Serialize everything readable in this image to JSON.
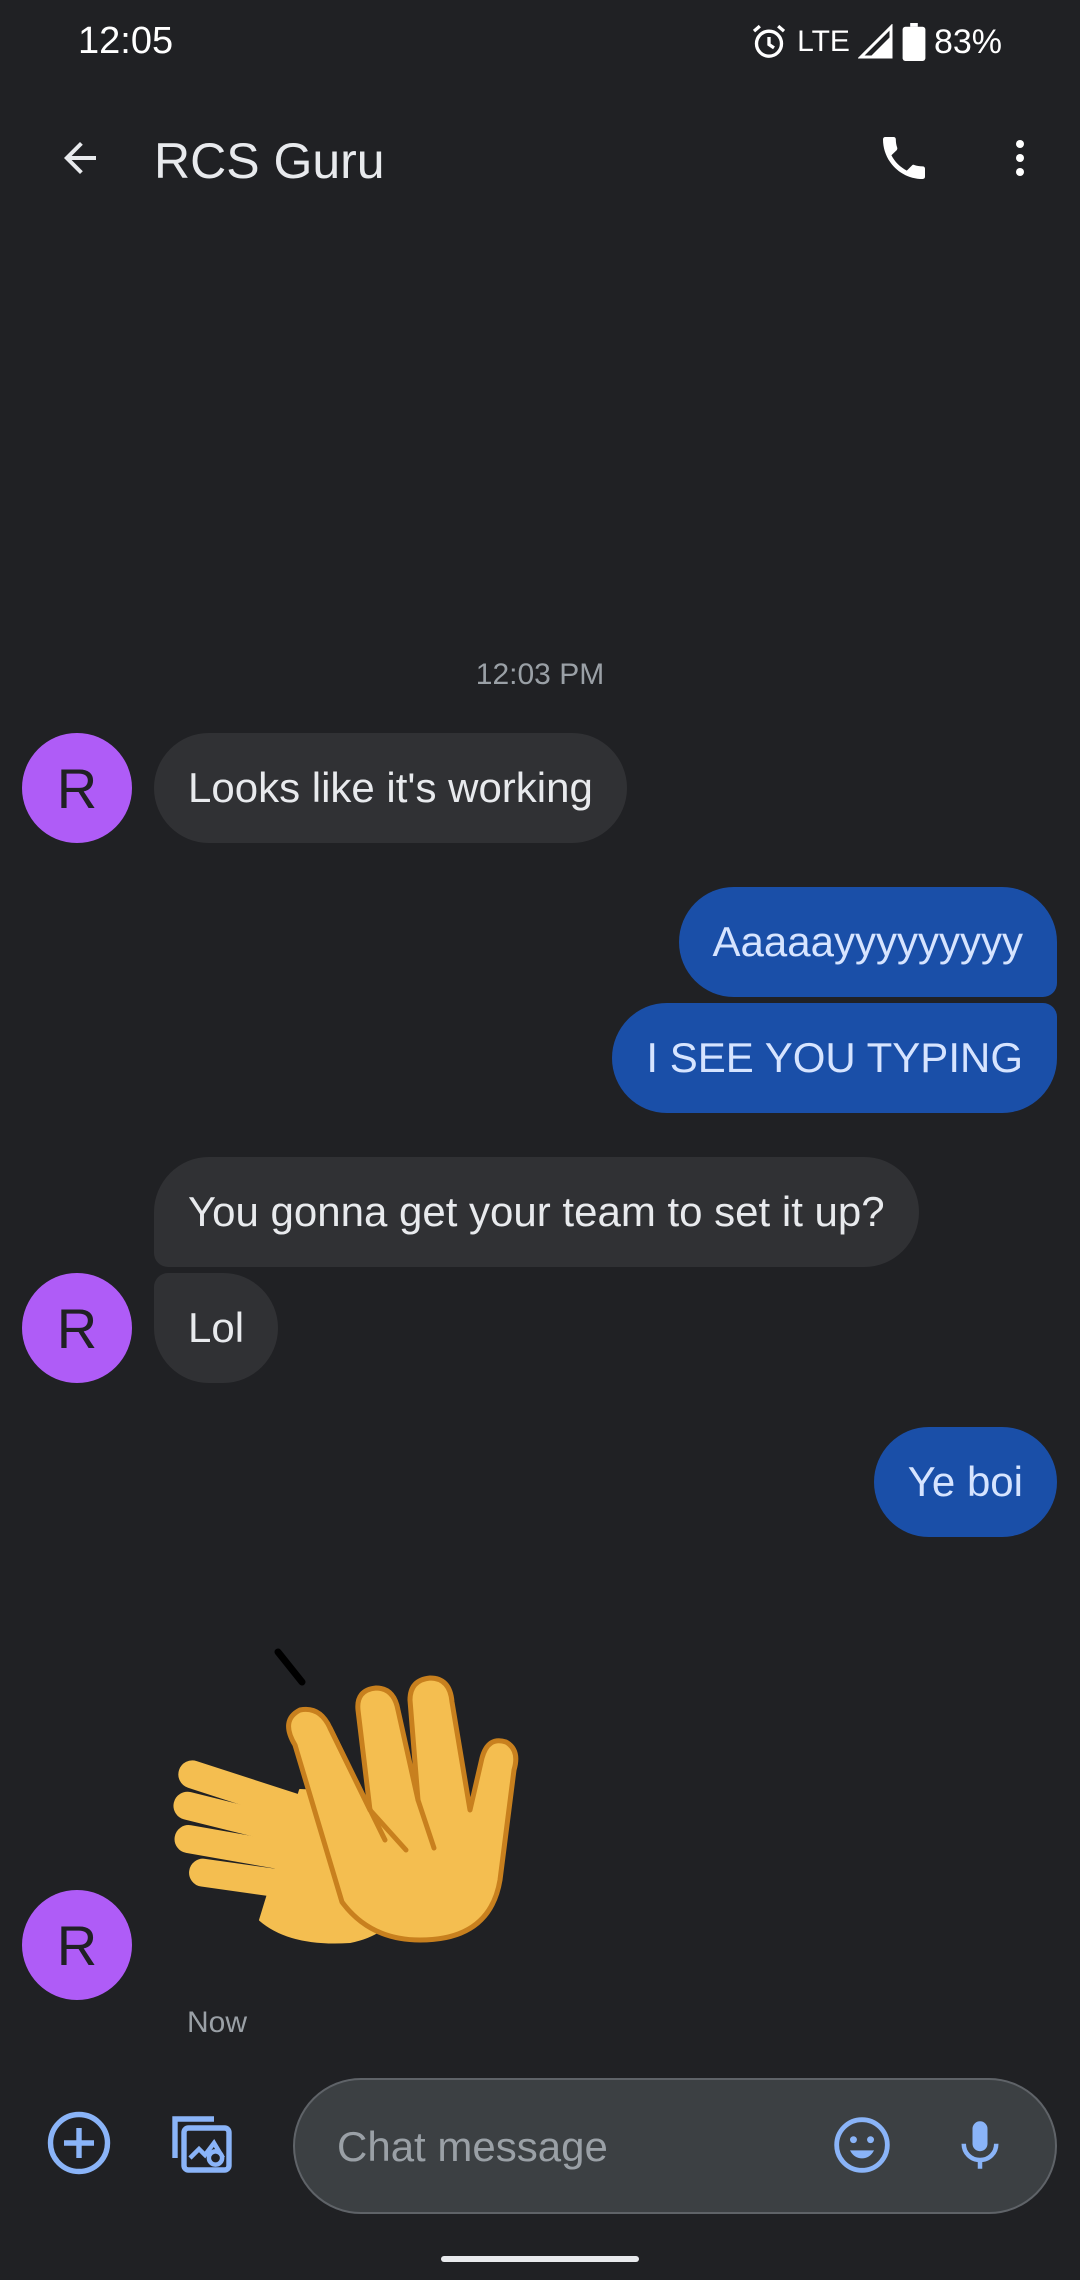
{
  "status_bar": {
    "time": "12:05",
    "network": "LTE",
    "battery": "83%"
  },
  "header": {
    "title": "RCS Guru",
    "icons": [
      "back-arrow-icon",
      "phone-icon",
      "more-vert-icon"
    ]
  },
  "conversation": {
    "timestamp": "12:03 PM",
    "avatar_initial": "R",
    "avatar_color": "#af5cf7",
    "incoming_color": "#303134",
    "outgoing_color": "#1a4fa8",
    "messages": [
      {
        "direction": "incoming",
        "text": "Looks like it's working"
      },
      {
        "direction": "outgoing",
        "text": "Aaaaayyyyyyyyy"
      },
      {
        "direction": "outgoing",
        "text": "I SEE YOU TYPING"
      },
      {
        "direction": "incoming",
        "text": "You gonna get your team to set it up?"
      },
      {
        "direction": "incoming",
        "text": "Lol"
      },
      {
        "direction": "outgoing",
        "text": "Ye boi"
      },
      {
        "direction": "incoming",
        "content": "clapping-hands-emoji"
      }
    ],
    "last_time": "Now"
  },
  "compose": {
    "placeholder": "Chat message",
    "icons": [
      "add-circle-icon",
      "gallery-icon",
      "emoji-icon",
      "mic-icon"
    ]
  }
}
